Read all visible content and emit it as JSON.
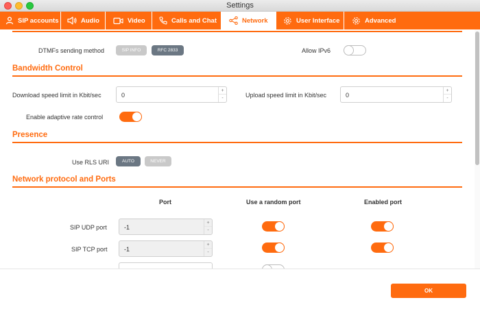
{
  "window": {
    "title": "Settings"
  },
  "tabs": [
    {
      "label": "SIP accounts",
      "icon": "user-icon"
    },
    {
      "label": "Audio",
      "icon": "speaker-icon"
    },
    {
      "label": "Video",
      "icon": "video-camera-icon"
    },
    {
      "label": "Calls and Chat",
      "icon": "phone-icon"
    },
    {
      "label": "Network",
      "icon": "share-network-icon",
      "active": true
    },
    {
      "label": "User Interface",
      "icon": "gear-icon"
    },
    {
      "label": "Advanced",
      "icon": "gear-icon"
    }
  ],
  "dtmf": {
    "label": "DTMFs sending method",
    "options": [
      "SIP INFO",
      "RFC 2833"
    ],
    "selected": "RFC 2833"
  },
  "ipv6": {
    "label": "Allow IPv6",
    "enabled": false
  },
  "bandwidth": {
    "title": "Bandwidth Control",
    "download_label": "Download speed limit in Kbit/sec",
    "download_value": "0",
    "upload_label": "Upload speed limit in Kbit/sec",
    "upload_value": "0",
    "adaptive_label": "Enable adaptive rate control",
    "adaptive_enabled": true
  },
  "presence": {
    "title": "Presence",
    "rls_label": "Use RLS URI",
    "options": [
      "AUTO",
      "NEVER"
    ],
    "selected": "AUTO"
  },
  "ports": {
    "title": "Network protocol and Ports",
    "columns": [
      "Port",
      "Use a random port",
      "Enabled port"
    ],
    "rows": [
      {
        "label": "SIP UDP port",
        "value": "-1",
        "random": true,
        "enabled": true
      },
      {
        "label": "SIP TCP port",
        "value": "-1",
        "random": true,
        "enabled": true
      },
      {
        "label": "",
        "value": "",
        "random": false,
        "enabled": null
      }
    ]
  },
  "stepper": {
    "plus": "+",
    "minus": "-"
  },
  "footer": {
    "ok_label": "OK"
  },
  "colors": {
    "accent": "#ff6b0f",
    "pill_on": "#6b7783",
    "pill_off": "#c9c9c9"
  }
}
